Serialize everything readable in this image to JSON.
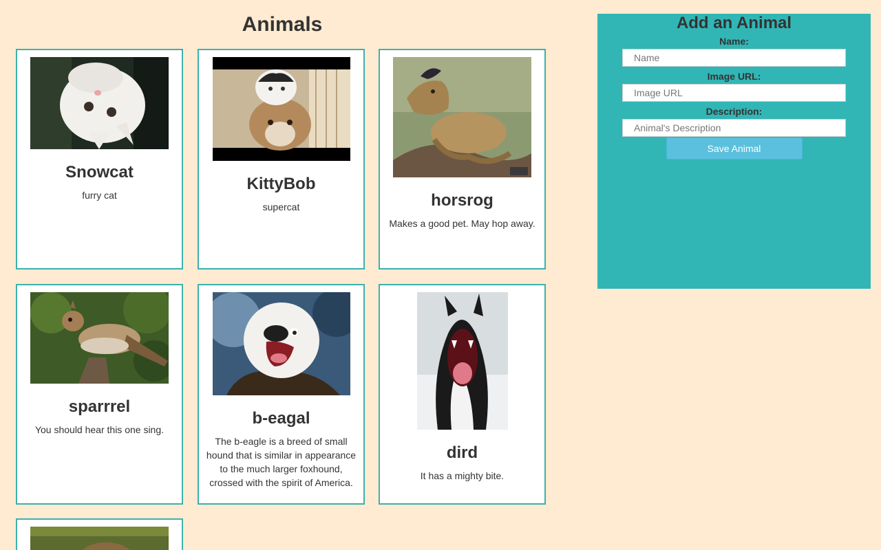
{
  "page": {
    "title": "Animals"
  },
  "animals": [
    {
      "name": "Snowcat",
      "description": "furry cat",
      "image": "white cat lying upside down"
    },
    {
      "name": "KittyBob",
      "description": "supercat",
      "image": "cat sitting on a cougar's head"
    },
    {
      "name": "horsrog",
      "description": "Makes a good pet. May hop away.",
      "image": "horse-headed frog on a log"
    },
    {
      "name": "sparrrel",
      "description": "You should hear this one sing.",
      "image": "squirrel-headed sparrow on a branch"
    },
    {
      "name": "b-eagal",
      "description": "The b-eagle is a breed of small hound that is similar in appearance to the much larger foxhound, crossed with the spirit of America.",
      "image": "dog-faced bald eagle"
    },
    {
      "name": "dird",
      "description": "It has a mighty bite.",
      "image": "dog-headed penguin with open mouth"
    },
    {
      "name": "",
      "description": "",
      "image": "animal in grass (partially visible)"
    }
  ],
  "form": {
    "title": "Add an Animal",
    "name_label": "Name:",
    "name_placeholder": "Name",
    "image_label": "Image URL:",
    "image_placeholder": "Image URL",
    "description_label": "Description:",
    "description_placeholder": "Animal's Description",
    "save_label": "Save Animal"
  },
  "colors": {
    "background": "#feebd1",
    "card_border": "#3bb1ad",
    "panel": "#31b6b5",
    "button": "#5bc0de"
  }
}
